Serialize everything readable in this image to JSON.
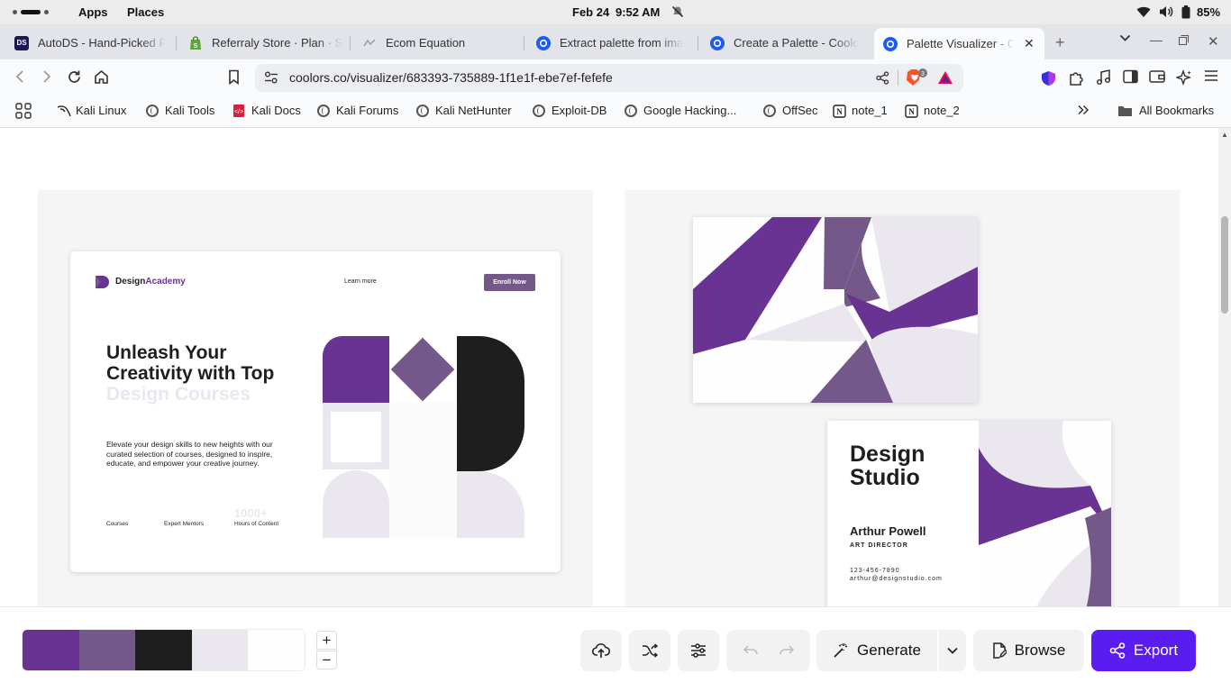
{
  "os": {
    "apps": "Apps",
    "places": "Places",
    "date": "Feb 24",
    "time": "9:52 AM",
    "battery": "85%"
  },
  "tabs": [
    {
      "label": "AutoDS - Hand-Picked F",
      "favicon": "DS"
    },
    {
      "label": "Referraly Store · Plan · S"
    },
    {
      "label": "Ecom Equation"
    },
    {
      "label": "Extract palette from ima"
    },
    {
      "label": "Create a Palette - Coolo"
    },
    {
      "label": "Palette Visualizer - C"
    }
  ],
  "address": {
    "url": "coolors.co/visualizer/683393-735889-1f1e1f-ebe7ef-fefefe",
    "shields_count": "3"
  },
  "bookmarks": {
    "items": [
      "Kali Linux",
      "Kali Tools",
      "Kali Docs",
      "Kali Forums",
      "Kali NetHunter",
      "Exploit-DB",
      "Google Hacking...",
      "OffSec",
      "note_1",
      "note_2"
    ],
    "all": "All Bookmarks"
  },
  "landing": {
    "brand_prefix": "Design",
    "brand_accent": "Academy",
    "learn_more": "Learn more",
    "enroll": "Enroll Now",
    "headline_dark": "Unleash Your Creativity with Top",
    "headline_light": "Design Courses",
    "description": "Elevate your design skills to new heights with our curated selection of courses, designed to inspire, educate, and empower your creative journey.",
    "stats": [
      {
        "value": "",
        "label": "Courses"
      },
      {
        "value": "",
        "label": "Expert Mentors"
      },
      {
        "value": "1000+",
        "label": "Hours of Content"
      }
    ]
  },
  "business_card": {
    "title": "Design Studio",
    "name": "Arthur Powell",
    "role": "ART DIRECTOR",
    "phone": "123-456-7890",
    "email": "arthur@designstudio.com"
  },
  "palette": {
    "colors": [
      "#683393",
      "#735889",
      "#1f1e1f",
      "#ebe7ef",
      "#fefefe"
    ]
  },
  "actions": {
    "generate": "Generate",
    "browse": "Browse",
    "export": "Export",
    "zoom_in": "+",
    "zoom_out": "−"
  }
}
